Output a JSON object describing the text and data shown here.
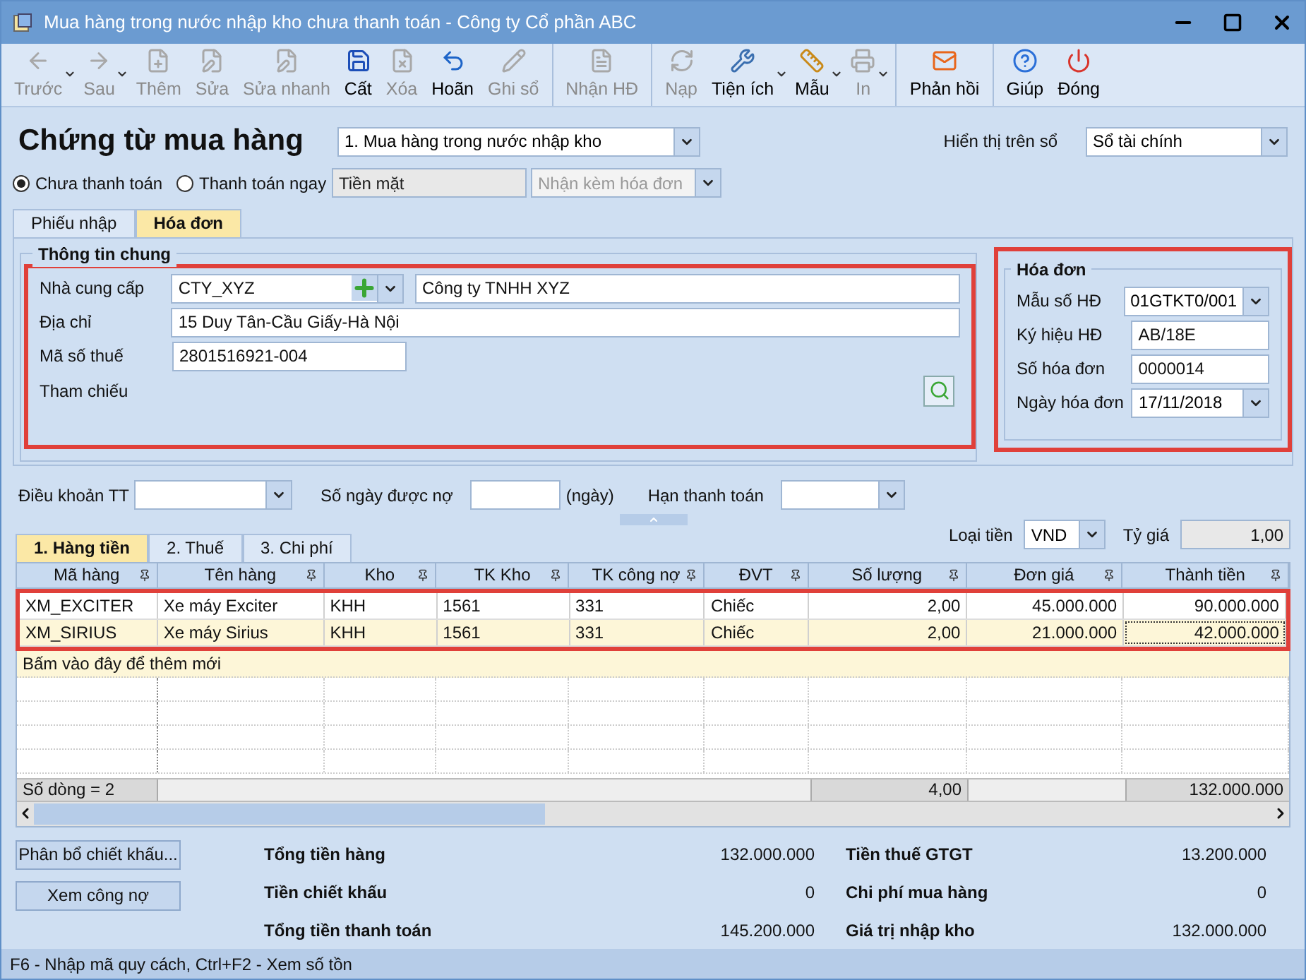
{
  "window": {
    "title": "Mua hàng trong nước nhập kho chưa thanh toán - Công ty Cổ phần ABC"
  },
  "toolbar": {
    "groups": [
      [
        {
          "label": "Trước",
          "disabled": true,
          "dropdown": true
        },
        {
          "label": "Sau",
          "disabled": true,
          "dropdown": true
        },
        {
          "label": "Thêm",
          "disabled": true,
          "dropdown": false
        },
        {
          "label": "Sửa",
          "disabled": true,
          "dropdown": false
        },
        {
          "label": "Sửa nhanh",
          "disabled": true,
          "dropdown": false
        },
        {
          "label": "Cất",
          "disabled": false,
          "dropdown": false
        },
        {
          "label": "Xóa",
          "disabled": true,
          "dropdown": false
        },
        {
          "label": "Hoãn",
          "disabled": false,
          "dropdown": false
        },
        {
          "label": "Ghi sổ",
          "disabled": true,
          "dropdown": false
        }
      ],
      [
        {
          "label": "Nhận HĐ",
          "disabled": true,
          "dropdown": false
        }
      ],
      [
        {
          "label": "Nạp",
          "disabled": true,
          "dropdown": false
        },
        {
          "label": "Tiện ích",
          "disabled": false,
          "dropdown": true
        },
        {
          "label": "Mẫu",
          "disabled": false,
          "dropdown": true
        },
        {
          "label": "In",
          "disabled": true,
          "dropdown": true
        }
      ],
      [
        {
          "label": "Phản hồi",
          "disabled": false,
          "dropdown": false
        }
      ],
      [
        {
          "label": "Giúp",
          "disabled": false,
          "dropdown": false
        },
        {
          "label": "Đóng",
          "disabled": false,
          "dropdown": false
        }
      ]
    ]
  },
  "heading": "Chứng từ mua hàng",
  "voucher_type": {
    "value": "1. Mua hàng trong nước nhập kho"
  },
  "ledger": {
    "label": "Hiển thị trên sổ",
    "value": "Sổ tài chính"
  },
  "payment": [
    {
      "label": "Chưa thanh toán",
      "selected": true
    },
    {
      "label": "Thanh toán ngay",
      "selected": false
    }
  ],
  "payment_method": {
    "value": "Tiền mặt",
    "disabled": true
  },
  "invoice_option": {
    "value": "Nhận kèm hóa đơn",
    "disabled": true
  },
  "tabs": [
    {
      "label": "Phiếu nhập",
      "selected": false
    },
    {
      "label": "Hóa đơn",
      "selected": true
    }
  ],
  "general_info": {
    "title": "Thông tin chung",
    "supplier_label": "Nhà cung cấp",
    "supplier_code": "CTY_XYZ",
    "supplier_name": "Công ty TNHH XYZ",
    "address_label": "Địa chỉ",
    "address": "15 Duy Tân-Cầu Giấy-Hà Nội",
    "tax_label": "Mã số thuế",
    "tax_code": "2801516921-004",
    "reference_label": "Tham chiếu"
  },
  "invoice": {
    "title": "Hóa đơn",
    "fields": [
      {
        "label": "Mẫu số HĐ",
        "value": "01GTKT0/001",
        "kind": "dropdown"
      },
      {
        "label": "Ký hiệu HĐ",
        "value": "AB/18E",
        "kind": "text"
      },
      {
        "label": "Số hóa đơn",
        "value": "0000014",
        "kind": "text"
      },
      {
        "label": "Ngày hóa đơn",
        "value": "17/11/2018",
        "kind": "dropdown"
      }
    ]
  },
  "terms": {
    "payment_terms_label": "Điều khoản TT",
    "credit_days_label": "Số ngày được nợ",
    "days_unit": "(ngày)",
    "due_date_label": "Hạn thanh toán"
  },
  "detail_tabs": [
    {
      "label": "1. Hàng tiền",
      "selected": true
    },
    {
      "label": "2. Thuế",
      "selected": false
    },
    {
      "label": "3. Chi phí",
      "selected": false
    }
  ],
  "currency": {
    "label": "Loại tiền",
    "value": "VND",
    "rate_label": "Tỷ giá",
    "rate": "1,00"
  },
  "table": {
    "columns": [
      "Mã hàng",
      "Tên hàng",
      "Kho",
      "TK Kho",
      "TK công nợ",
      "ĐVT",
      "Số lượng",
      "Đơn giá",
      "Thành tiền"
    ],
    "rows": [
      {
        "cells": [
          "XM_EXCITER",
          "Xe máy Exciter",
          "KHH",
          "1561",
          "331",
          "Chiếc",
          "2,00",
          "45.000.000",
          "90.000.000"
        ],
        "selected": false
      },
      {
        "cells": [
          "XM_SIRIUS",
          "Xe máy Sirius",
          "KHH",
          "1561",
          "331",
          "Chiếc",
          "2,00",
          "21.000.000",
          "42.000.000"
        ],
        "selected": true
      }
    ],
    "new_row_hint": "Bấm vào đây để thêm mới",
    "footer": {
      "count": "Số dòng = 2",
      "quantity": "4,00",
      "amount": "132.000.000"
    }
  },
  "actions": [
    "Phân bổ chiết khấu...",
    "Xem công nợ"
  ],
  "totals": [
    {
      "label": "Tổng tiền hàng",
      "value": "132.000.000"
    },
    {
      "label": "Tiền thuế GTGT",
      "value": "13.200.000"
    },
    {
      "label": "Tiền chiết khấu",
      "value": "0"
    },
    {
      "label": "Chi phí mua hàng",
      "value": "0"
    },
    {
      "label": "Tổng tiền thanh toán",
      "value": "145.200.000"
    },
    {
      "label": "Giá trị nhập kho",
      "value": "132.000.000"
    }
  ],
  "status_bar": "F6 - Nhập mã quy cách, Ctrl+F2 - Xem số tồn"
}
